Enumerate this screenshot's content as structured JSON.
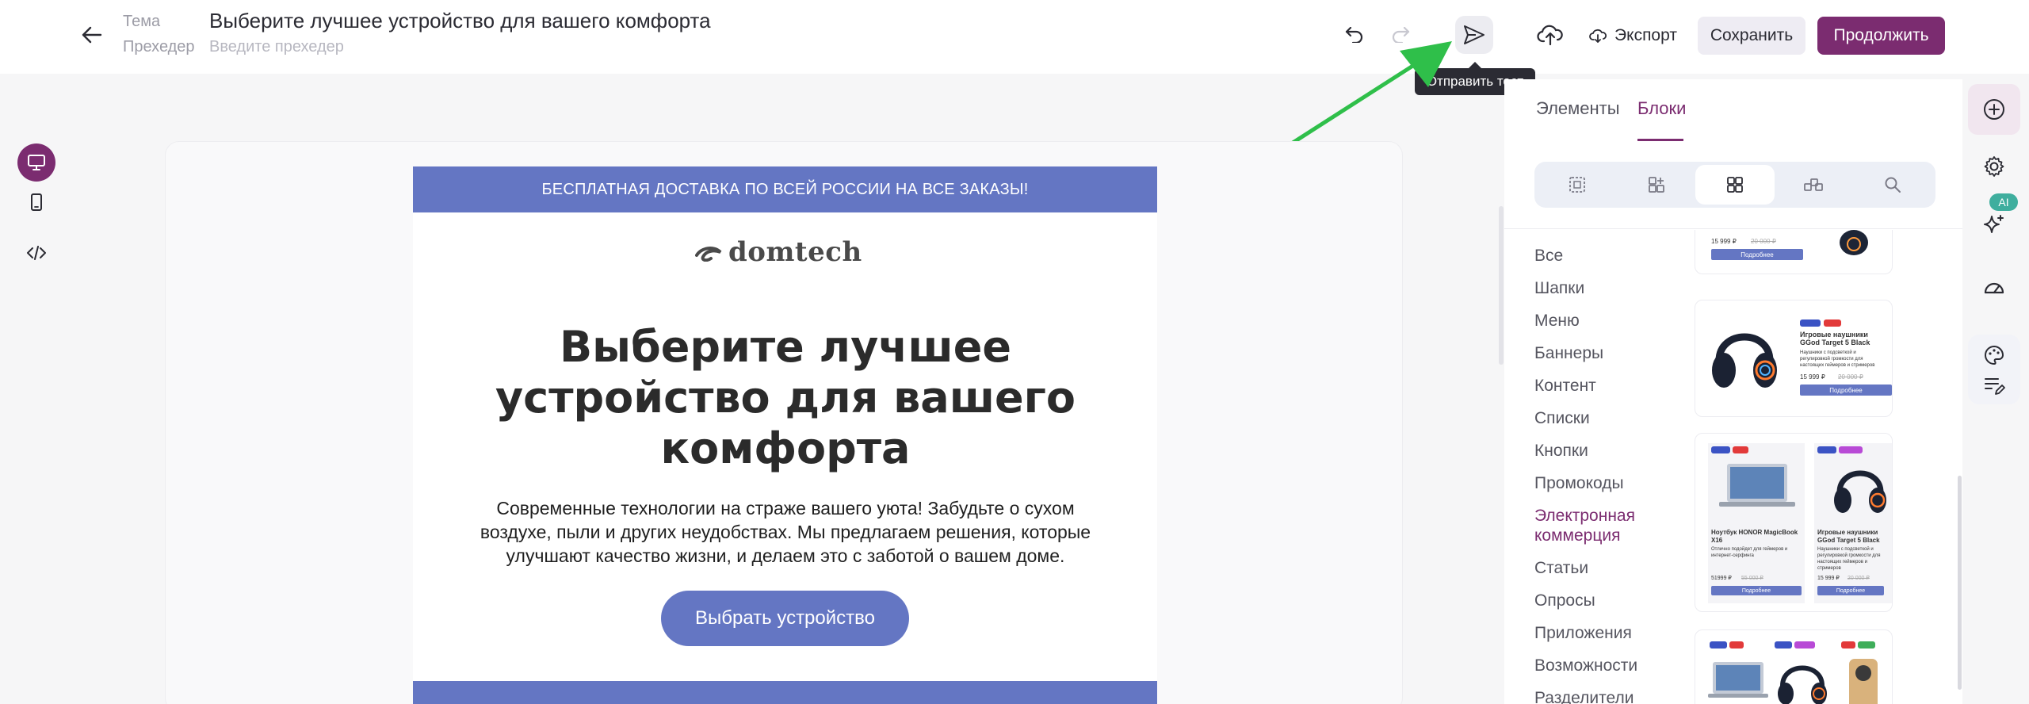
{
  "header": {
    "subject_label": "Тема",
    "preheader_label": "Прехедер",
    "subject_value": "Выберите лучшее устройство для вашего комфорта",
    "preheader_placeholder": "Введите прехедер",
    "export_label": "Экспорт",
    "save_label": "Сохранить",
    "continue_label": "Продолжить",
    "send_test_tooltip": "Отправить тест"
  },
  "colors": {
    "brand": "#7b2c70",
    "email_accent": "#6476c3",
    "annotation_arrow": "#2fbf4a"
  },
  "email": {
    "banner": "БЕСПЛАТНАЯ ДОСТАВКА ПО ВСЕЙ РОССИИ НА ВСЕ ЗАКАЗЫ!",
    "logo": "domtech",
    "headline_lines": [
      "Выберите лучшее",
      "устройство для вашего",
      "комфорта"
    ],
    "body_lines": [
      "Современные технологии на страже вашего уюта! Забудьте о сухом",
      "воздухе, пыли и других неудобствах. Мы предлагаем решения, которые",
      "улучшают качество жизни, и делаем это с заботой о вашем доме."
    ],
    "cta": "Выбрать устройство"
  },
  "panel": {
    "tabs": [
      {
        "label": "Элементы",
        "active": false
      },
      {
        "label": "Блоки",
        "active": true
      }
    ],
    "segments": [
      "layout-icon",
      "add-block-icon",
      "grid-icon",
      "saved-blocks-icon",
      "search-icon"
    ],
    "active_segment": 2,
    "categories": [
      {
        "label": "Все",
        "active": false
      },
      {
        "label": "Шапки",
        "active": false
      },
      {
        "label": "Меню",
        "active": false
      },
      {
        "label": "Баннеры",
        "active": false
      },
      {
        "label": "Контент",
        "active": false
      },
      {
        "label": "Списки",
        "active": false
      },
      {
        "label": "Кнопки",
        "active": false
      },
      {
        "label": "Промокоды",
        "active": false
      },
      {
        "label": "Электронная коммерция",
        "active": true
      },
      {
        "label": "Статьи",
        "active": false
      },
      {
        "label": "Опросы",
        "active": false
      },
      {
        "label": "Приложения",
        "active": false
      },
      {
        "label": "Возможности",
        "active": false
      },
      {
        "label": "Разделители",
        "active": false
      }
    ],
    "thumbnails": {
      "button_label": "Подробнее",
      "headphones_title": "Игровые наушники GGod Target 5 Black",
      "headphones_desc": "Наушники с подсветкой и регулировкой громкости для настоящих геймеров и стримеров",
      "headphones_price": "15 999 ₽",
      "headphones_old_price": "20 000 ₽",
      "laptop_title": "Ноутбук HONOR MagicBook X16",
      "laptop_desc": "Отлично подойдет для геймеров и интернет-серфинга",
      "laptop_price": "51999 ₽",
      "laptop_old_price": "55 000 ₽"
    }
  }
}
